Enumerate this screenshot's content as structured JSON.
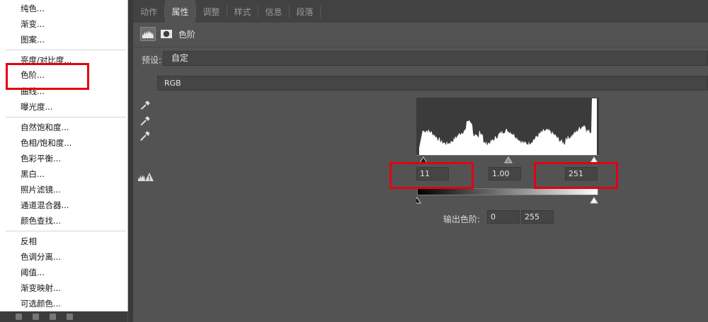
{
  "menu": {
    "items": [
      "纯色...",
      "渐变...",
      "图案...",
      "亮度/对比度...",
      "色阶...",
      "曲线...",
      "曝光度...",
      "自然饱和度...",
      "色相/饱和度...",
      "色彩平衡...",
      "黑白...",
      "照片滤镜...",
      "通道混合器...",
      "颜色查找...",
      "反相",
      "色调分离...",
      "阈值...",
      "渐变映射...",
      "可选颜色..."
    ],
    "highlighted": "色阶..."
  },
  "tabs": [
    {
      "label": "动作",
      "active": false
    },
    {
      "label": "属性",
      "active": true
    },
    {
      "label": "调整",
      "active": false
    },
    {
      "label": "样式",
      "active": false
    },
    {
      "label": "信息",
      "active": false
    },
    {
      "label": "段落",
      "active": false
    }
  ],
  "properties": {
    "title": "色阶",
    "preset_label": "预设:",
    "preset_value": "自定",
    "channel": "RGB"
  },
  "input_levels": {
    "black": "11",
    "gamma": "1.00",
    "white": "251"
  },
  "output_levels": {
    "label": "输出色阶:",
    "black": "0",
    "white": "255"
  },
  "icons": [
    "levels-icon",
    "mask-icon",
    "black-eyedropper-icon",
    "gray-eyedropper-icon",
    "white-eyedropper-icon",
    "auto-warning-icon"
  ],
  "colors": {
    "panel_bg": "#535353",
    "tab_bar_bg": "#424242",
    "highlight": "#e3000f"
  }
}
